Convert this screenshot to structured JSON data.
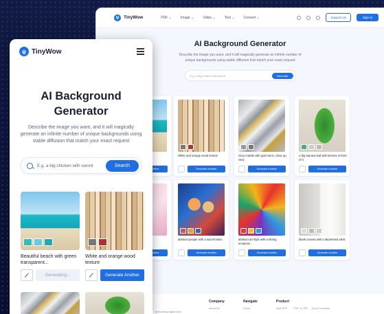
{
  "brand": {
    "name": "TinyWow",
    "mark": "ψ"
  },
  "desktop": {
    "nav": [
      "PDF",
      "Image",
      "Video",
      "Text",
      "Convert"
    ],
    "support": "Support Us",
    "signin": "Sign In",
    "title": "AI Background Generator",
    "desc": "Describe the image you want, and it will magically generate an infinite number of unique backgrounds using stable diffusion that match your exact request",
    "search_placeholder": "E.g. a big chicken with sword",
    "search_button": "Generate",
    "generate_label": "Generate Another",
    "cards": [
      {
        "caption": "een"
      },
      {
        "caption": "White and orange wood texture"
      },
      {
        "caption": "Grey marble with gold veins, close up view"
      },
      {
        "caption": "A big banana leaf with lemons in front of it"
      },
      {
        "caption": "ude, view"
      },
      {
        "caption": "abstract people with a sad emotion"
      },
      {
        "caption": "abstract art style with a strong emotions"
      },
      {
        "caption": "blank canvas with a depressed artist"
      }
    ],
    "footer": {
      "left_text": "generating digital tools",
      "company": {
        "title": "Company",
        "items": [
          "About Us"
        ]
      },
      "navigate": {
        "title": "Navigate",
        "items": [
          "Home"
        ]
      },
      "product": {
        "title": "Product",
        "items": [
          "Split PDF",
          "PDF to JPG",
          "Epub Converter"
        ]
      }
    }
  },
  "mobile": {
    "title_line1": "AI Background",
    "title_line2": "Generator",
    "desc": "Describe the image you want, and it will magically generate an infinite number of unique backgrounds using stable diffusion that match your exact request",
    "search_placeholder": "E.g. a big chicken with sword",
    "search_button": "Search",
    "cards": [
      {
        "caption": "Beautiful beach with green transparent...",
        "button": "Generating..."
      },
      {
        "caption": "White and orange wood texture",
        "button": "Generate Another"
      }
    ]
  },
  "colors": {
    "accent": "#1f6fe0",
    "background": "#0b1233"
  }
}
